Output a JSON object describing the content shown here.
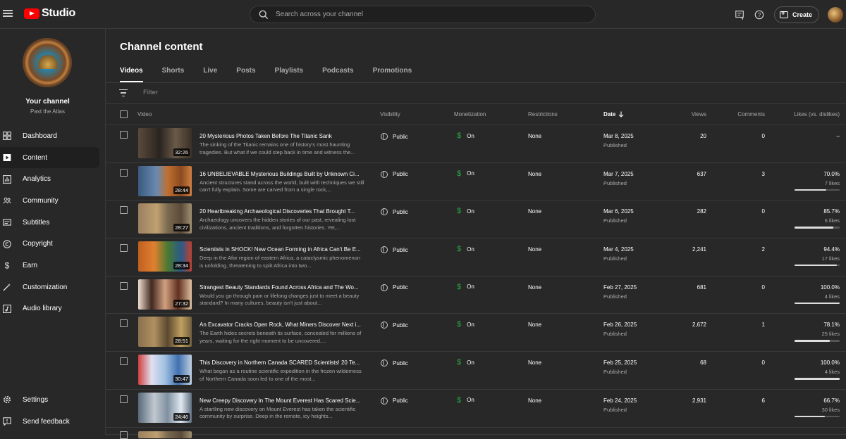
{
  "app": {
    "name": "Studio",
    "brand_color": "#ff0000"
  },
  "search": {
    "placeholder": "Search across your channel"
  },
  "header": {
    "create_label": "Create"
  },
  "channel": {
    "title": "Your channel",
    "name": "Past the Atlas"
  },
  "sidebar": {
    "items": [
      {
        "label": "Dashboard",
        "icon": "dashboard-icon"
      },
      {
        "label": "Content",
        "icon": "content-icon",
        "active": true
      },
      {
        "label": "Analytics",
        "icon": "analytics-icon"
      },
      {
        "label": "Community",
        "icon": "community-icon"
      },
      {
        "label": "Subtitles",
        "icon": "subtitles-icon"
      },
      {
        "label": "Copyright",
        "icon": "copyright-icon"
      },
      {
        "label": "Earn",
        "icon": "earn-icon"
      },
      {
        "label": "Customization",
        "icon": "customization-icon"
      },
      {
        "label": "Audio library",
        "icon": "audio-library-icon"
      }
    ],
    "bottom": [
      {
        "label": "Settings",
        "icon": "settings-icon"
      },
      {
        "label": "Send feedback",
        "icon": "feedback-icon"
      }
    ]
  },
  "main": {
    "title": "Channel content",
    "tabs": [
      "Videos",
      "Shorts",
      "Live",
      "Posts",
      "Playlists",
      "Podcasts",
      "Promotions"
    ],
    "active_tab": "Videos",
    "filter_placeholder": "Filter"
  },
  "table": {
    "columns": {
      "video": "Video",
      "visibility": "Visibility",
      "monetization": "Monetization",
      "restrictions": "Restrictions",
      "date": "Date",
      "views": "Views",
      "comments": "Comments",
      "likes": "Likes (vs. dislikes)"
    },
    "rows": [
      {
        "title": "20 Mysterious Photos Taken Before The Titanic Sank",
        "description": "The sinking of the Titanic remains one of history's most haunting tragedies. But what if we could step back in time and witness the...",
        "duration": "32:26",
        "visibility": "Public",
        "monetization": "On",
        "restrictions": "None",
        "date": "Mar 8, 2025",
        "status": "Published",
        "views": "20",
        "comments": "0",
        "likes_pct": "–",
        "likes_count": "",
        "likes_ratio": null
      },
      {
        "title": "16 UNBELIEVABLE Mysterious Buildings Built by Unknown Ci...",
        "description": "Ancient structures stand across the world, built with techniques we still can't fully explain. Some are carved from a single rock,...",
        "duration": "28:44",
        "visibility": "Public",
        "monetization": "On",
        "restrictions": "None",
        "date": "Mar 7, 2025",
        "status": "Published",
        "views": "637",
        "comments": "3",
        "likes_pct": "70.0%",
        "likes_count": "7 likes",
        "likes_ratio": 0.7
      },
      {
        "title": "20 Heartbreaking Archaeological Discoveries That Brought T...",
        "description": "Archaeology uncovers the hidden stories of our past, revealing lost civilizations, ancient traditions, and forgotten histories. Yet,...",
        "duration": "28:27",
        "visibility": "Public",
        "monetization": "On",
        "restrictions": "None",
        "date": "Mar 6, 2025",
        "status": "Published",
        "views": "282",
        "comments": "0",
        "likes_pct": "85.7%",
        "likes_count": "6 likes",
        "likes_ratio": 0.857
      },
      {
        "title": "Scientists in SHOCK! New Ocean Forming in Africa Can't Be E...",
        "description": "Deep in the Afar region of eastern Africa, a cataclysmic phenomenon is unfolding, threatening to split Africa into two...",
        "duration": "28:34",
        "visibility": "Public",
        "monetization": "On",
        "restrictions": "None",
        "date": "Mar 4, 2025",
        "status": "Published",
        "views": "2,241",
        "comments": "2",
        "likes_pct": "94.4%",
        "likes_count": "17 likes",
        "likes_ratio": 0.944
      },
      {
        "title": "Strangest Beauty Standards Found Across Africa and The Wo...",
        "description": "Would you go through pain or lifelong changes just to meet a beauty standard? In many cultures, beauty isn't just about...",
        "duration": "27:32",
        "visibility": "Public",
        "monetization": "On",
        "restrictions": "None",
        "date": "Feb 27, 2025",
        "status": "Published",
        "views": "681",
        "comments": "0",
        "likes_pct": "100.0%",
        "likes_count": "4 likes",
        "likes_ratio": 1.0
      },
      {
        "title": "An Excavator Cracks Open Rock, What Miners Discover Next i...",
        "description": "The Earth hides secrets beneath its surface, concealed for millions of years, waiting for the right moment to be uncovered....",
        "duration": "28:51",
        "visibility": "Public",
        "monetization": "On",
        "restrictions": "None",
        "date": "Feb 26, 2025",
        "status": "Published",
        "views": "2,672",
        "comments": "1",
        "likes_pct": "78.1%",
        "likes_count": "25 likes",
        "likes_ratio": 0.781
      },
      {
        "title": "This Discovery in Northern Canada SCARED Scientists! 20 Te...",
        "description": "What began as a routine scientific expedition in the frozen wilderness of Northern Canada soon led to one of the most...",
        "duration": "30:47",
        "visibility": "Public",
        "monetization": "On",
        "restrictions": "None",
        "date": "Feb 25, 2025",
        "status": "Published",
        "views": "68",
        "comments": "0",
        "likes_pct": "100.0%",
        "likes_count": "4 likes",
        "likes_ratio": 1.0
      },
      {
        "title": "New Creepy Discovery In The Mount Everest Has Scared Scie...",
        "description": "A startling new discovery on Mount Everest has taken the scientific community by surprise. Deep in the remote, icy heights...",
        "duration": "24:46",
        "visibility": "Public",
        "monetization": "On",
        "restrictions": "None",
        "date": "Feb 24, 2025",
        "status": "Published",
        "views": "2,931",
        "comments": "6",
        "likes_pct": "66.7%",
        "likes_count": "30 likes",
        "likes_ratio": 0.667
      }
    ]
  }
}
